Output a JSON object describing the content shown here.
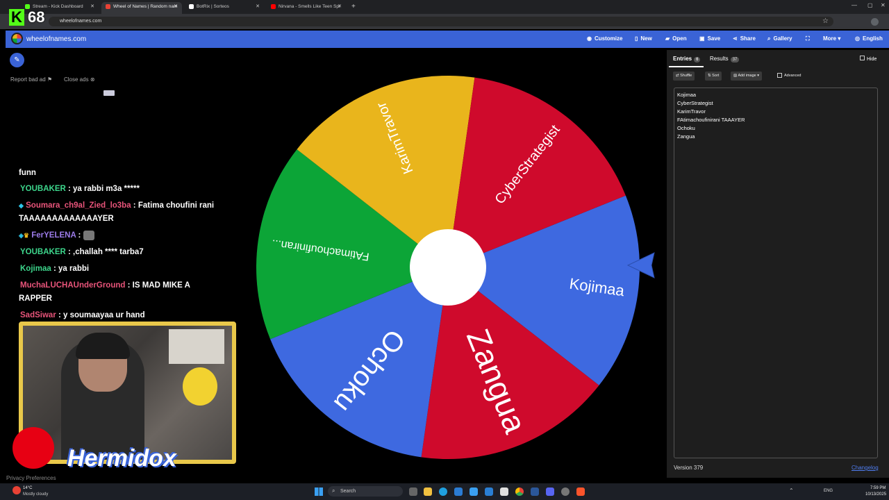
{
  "browser": {
    "tabs": [
      {
        "label": "Stream - Kick Dashboard",
        "color": "#53fc18"
      },
      {
        "label": "Wheel of Names | Random nam",
        "color": "#e94235"
      },
      {
        "label": "BotRix | Sorteos",
        "color": "#ffffff"
      },
      {
        "label": "Nirvana - Smells Like Teen Spi",
        "color": "#ff0000"
      }
    ],
    "url": "wheelofnames.com"
  },
  "overlay": {
    "kick_logo": "K",
    "viewer_count": "68"
  },
  "app": {
    "site_name": "wheelofnames.com",
    "nav": [
      "Customize",
      "New",
      "Open",
      "Save",
      "Share",
      "Gallery",
      "More",
      "English"
    ]
  },
  "ads": {
    "report": "Report bad ad",
    "close": "Close ads",
    "privacy": "Privacy Preferences"
  },
  "chat": [
    {
      "user": "",
      "color": "#ffffff",
      "text": "funn"
    },
    {
      "user": "YOUBAKER",
      "color": "#3dd68c",
      "text": " : ya rabbi m3a *****"
    },
    {
      "user": "Soumara_ch9al_Zied_lo3ba",
      "color": "#e8547a",
      "text": " : Fatima choufini rani TAAAAAAAAAAAAAYER"
    },
    {
      "user": "FerYELENA",
      "color": "#9b7be8",
      "text": " : "
    },
    {
      "user": "YOUBAKER",
      "color": "#3dd68c",
      "text": " : ,challah **** tarba7"
    },
    {
      "user": "Kojimaa",
      "color": "#3dd68c",
      "text": " : ya rabbi"
    },
    {
      "user": "MuchaLUCHAUnderGround",
      "color": "#e8547a",
      "text": " : IS MAD MIKE A RAPPER"
    },
    {
      "user": "SadSiwar",
      "color": "#e8547a",
      "text": " : y soumaayaa ur hand"
    }
  ],
  "webcam": {
    "streamer_name": "Hermidox"
  },
  "wheel": {
    "segments": [
      {
        "label": "Kojimaa",
        "color": "#3e69e0"
      },
      {
        "label": "Zangua",
        "color": "#cf0a2c"
      },
      {
        "label": "Ochoku",
        "color": "#3e69e0"
      },
      {
        "label": "FAtimachoufiniran...",
        "color": "#0ca537"
      },
      {
        "label": "KarimTravor",
        "color": "#e9b51c"
      },
      {
        "label": "CyberStrategist",
        "color": "#cf0a2c"
      }
    ]
  },
  "panel": {
    "tab_entries": "Entries",
    "entries_count": "6",
    "tab_results": "Results",
    "results_count": "37",
    "hide": "Hide",
    "shuffle": "Shuffle",
    "sort": "Sort",
    "add_image": "Add image",
    "advanced": "Advanced",
    "entries": [
      "Kojimaa",
      "CyberStrategist",
      "KarimTravor",
      "FAtimachoufinirani TAAAYER",
      "Ochoku",
      "Zangua"
    ],
    "version": "Version 379",
    "changelog": "Changelog"
  },
  "taskbar": {
    "weather_temp": "14°C",
    "weather_desc": "Mostly cloudy",
    "search_placeholder": "Search",
    "lang": "ENG",
    "time": "7:59 PM",
    "date": "10/13/2025"
  }
}
